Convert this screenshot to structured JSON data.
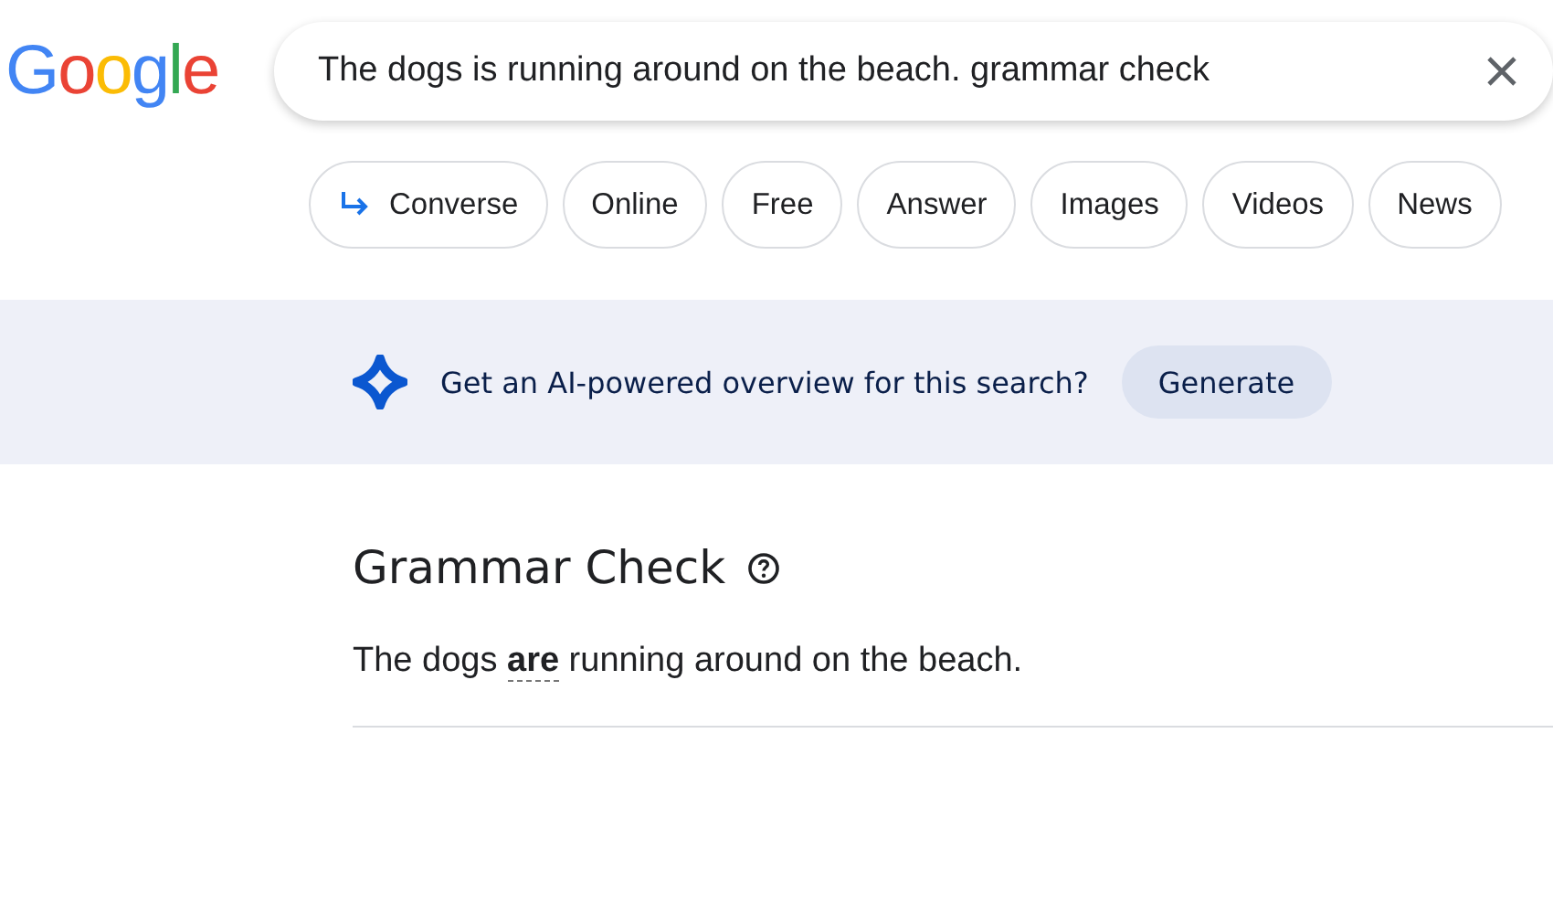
{
  "logo": "Google",
  "search": {
    "value": "The dogs is running around on the beach. grammar check"
  },
  "chips": [
    {
      "kind": "converse",
      "label": "Converse"
    },
    {
      "kind": "plain",
      "label": "Online"
    },
    {
      "kind": "plain",
      "label": "Free"
    },
    {
      "kind": "plain",
      "label": "Answer"
    },
    {
      "kind": "plain",
      "label": "Images"
    },
    {
      "kind": "plain",
      "label": "Videos"
    },
    {
      "kind": "plain",
      "label": "News"
    }
  ],
  "ai_banner": {
    "prompt": "Get an AI-powered overview for this search?",
    "button": "Generate"
  },
  "grammar_check": {
    "title": "Grammar Check",
    "corrected": "The dogs **are** running around on the beach."
  }
}
